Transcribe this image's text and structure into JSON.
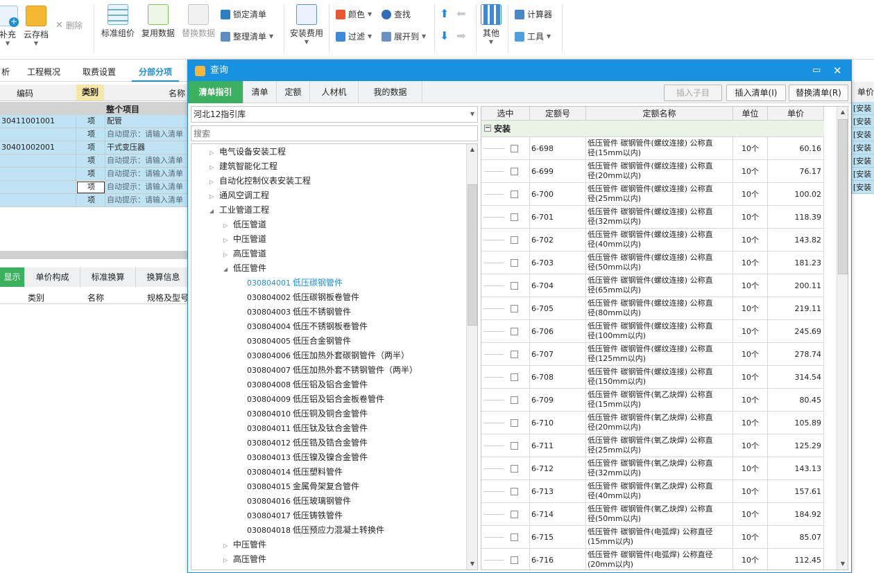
{
  "ribbon": {
    "supplement": "补充",
    "cloud_save": "云存档",
    "delete": "删除",
    "std_price": "标准组价",
    "reuse": "复用数据",
    "replace": "替换数据",
    "lock_list": "锁定清单",
    "arrange_list": "整理清单",
    "install_fee": "安装费用",
    "color": "颜色",
    "find": "查找",
    "filter": "过滤",
    "expand_to": "展开到",
    "other": "其他",
    "calculator": "计算器",
    "tools": "工具"
  },
  "main_tabs": [
    "析",
    "工程概况",
    "取费设置",
    "分部分项"
  ],
  "left_grid": {
    "headers": {
      "code": "编码",
      "type": "类别",
      "name": "名称"
    },
    "whole": "整个项目",
    "rows": [
      {
        "code": "30411001001",
        "type": "项",
        "name": "配管"
      },
      {
        "code": "",
        "type": "项",
        "name": "自动提示：请输入清单"
      },
      {
        "code": "30401002001",
        "type": "项",
        "name": "干式变压器"
      },
      {
        "code": "",
        "type": "项",
        "name": "自动提示：请输入清单"
      },
      {
        "code": "",
        "type": "项",
        "name": "自动提示：请输入清单"
      },
      {
        "code": "",
        "type": "项",
        "name": "自动提示：请输入清单"
      },
      {
        "code": "",
        "type": "项",
        "name": "自动提示：请输入清单"
      }
    ]
  },
  "right_strip": [
    "单价",
    "[安装",
    "[安装",
    "[安装",
    "[安装",
    "[安装",
    "[安装",
    "[安装"
  ],
  "lower_tabs": [
    "显示",
    "单价构成",
    "标准换算",
    "换算信息"
  ],
  "lower_headers": [
    "类别",
    "名称",
    "规格及型号"
  ],
  "dialog": {
    "title": "查询",
    "tabs": [
      "清单指引",
      "清单",
      "定额",
      "人材机",
      "我的数据"
    ],
    "btn_insert_child": "插入子目",
    "btn_insert_list": "插入清单(I)",
    "btn_replace_list": "替换清单(R)",
    "library": "河北12指引库",
    "search_placeholder": "搜索",
    "tree": [
      {
        "level": 1,
        "state": "closed",
        "code": "",
        "label": "电气设备安装工程"
      },
      {
        "level": 1,
        "state": "closed",
        "code": "",
        "label": "建筑智能化工程"
      },
      {
        "level": 1,
        "state": "closed",
        "code": "",
        "label": "自动化控制仪表安装工程"
      },
      {
        "level": 1,
        "state": "closed",
        "code": "",
        "label": "通风空调工程"
      },
      {
        "level": 1,
        "state": "open",
        "code": "",
        "label": "工业管道工程"
      },
      {
        "level": 2,
        "state": "closed",
        "code": "",
        "label": "低压管道"
      },
      {
        "level": 2,
        "state": "closed",
        "code": "",
        "label": "中压管道"
      },
      {
        "level": 2,
        "state": "closed",
        "code": "",
        "label": "高压管道"
      },
      {
        "level": 2,
        "state": "open",
        "code": "",
        "label": "低压管件"
      },
      {
        "level": 3,
        "state": "leaf",
        "code": "030804001",
        "label": "低压碳钢管件",
        "selected": true
      },
      {
        "level": 3,
        "state": "leaf",
        "code": "030804002",
        "label": "低压碳钢板卷管件"
      },
      {
        "level": 3,
        "state": "leaf",
        "code": "030804003",
        "label": "低压不锈钢管件"
      },
      {
        "level": 3,
        "state": "leaf",
        "code": "030804004",
        "label": "低压不锈钢板卷管件"
      },
      {
        "level": 3,
        "state": "leaf",
        "code": "030804005",
        "label": "低压合金钢管件"
      },
      {
        "level": 3,
        "state": "leaf",
        "code": "030804006",
        "label": "低压加热外套碳钢管件（两半）"
      },
      {
        "level": 3,
        "state": "leaf",
        "code": "030804007",
        "label": "低压加热外套不锈钢管件（两半）"
      },
      {
        "level": 3,
        "state": "leaf",
        "code": "030804008",
        "label": "低压铝及铝合金管件"
      },
      {
        "level": 3,
        "state": "leaf",
        "code": "030804009",
        "label": "低压铝及铝合金板卷管件"
      },
      {
        "level": 3,
        "state": "leaf",
        "code": "030804010",
        "label": "低压铜及铜合金管件"
      },
      {
        "level": 3,
        "state": "leaf",
        "code": "030804011",
        "label": "低压钛及钛合金管件"
      },
      {
        "level": 3,
        "state": "leaf",
        "code": "030804012",
        "label": "低压锆及锆合金管件"
      },
      {
        "level": 3,
        "state": "leaf",
        "code": "030804013",
        "label": "低压镍及镍合金管件"
      },
      {
        "level": 3,
        "state": "leaf",
        "code": "030804014",
        "label": "低压塑料管件"
      },
      {
        "level": 3,
        "state": "leaf",
        "code": "030804015",
        "label": "金属骨架复合管件"
      },
      {
        "level": 3,
        "state": "leaf",
        "code": "030804016",
        "label": "低压玻璃钢管件"
      },
      {
        "level": 3,
        "state": "leaf",
        "code": "030804017",
        "label": "低压铸铁管件"
      },
      {
        "level": 3,
        "state": "leaf",
        "code": "030804018",
        "label": "低压预应力混凝土转换件"
      },
      {
        "level": 2,
        "state": "closed",
        "code": "",
        "label": "中压管件"
      },
      {
        "level": 2,
        "state": "closed",
        "code": "",
        "label": "高压管件"
      }
    ],
    "table": {
      "headers": {
        "sel": "选中",
        "code": "定额号",
        "name": "定额名称",
        "unit": "单位",
        "price": "单价"
      },
      "group": "安装",
      "rows": [
        {
          "code": "6-698",
          "name1": "低压管件 碳钢管件(螺纹连接) 公称直",
          "name2": "径(15mm以内)",
          "unit": "10个",
          "price": "60.16"
        },
        {
          "code": "6-699",
          "name1": "低压管件 碳钢管件(螺纹连接) 公称直",
          "name2": "径(20mm以内)",
          "unit": "10个",
          "price": "76.17"
        },
        {
          "code": "6-700",
          "name1": "低压管件 碳钢管件(螺纹连接) 公称直",
          "name2": "径(25mm以内)",
          "unit": "10个",
          "price": "100.02"
        },
        {
          "code": "6-701",
          "name1": "低压管件 碳钢管件(螺纹连接) 公称直",
          "name2": "径(32mm以内)",
          "unit": "10个",
          "price": "118.39"
        },
        {
          "code": "6-702",
          "name1": "低压管件 碳钢管件(螺纹连接) 公称直",
          "name2": "径(40mm以内)",
          "unit": "10个",
          "price": "143.82"
        },
        {
          "code": "6-703",
          "name1": "低压管件 碳钢管件(螺纹连接) 公称直",
          "name2": "径(50mm以内)",
          "unit": "10个",
          "price": "181.23"
        },
        {
          "code": "6-704",
          "name1": "低压管件 碳钢管件(螺纹连接) 公称直",
          "name2": "径(65mm以内)",
          "unit": "10个",
          "price": "200.11"
        },
        {
          "code": "6-705",
          "name1": "低压管件 碳钢管件(螺纹连接) 公称直",
          "name2": "径(80mm以内)",
          "unit": "10个",
          "price": "219.11"
        },
        {
          "code": "6-706",
          "name1": "低压管件 碳钢管件(螺纹连接) 公称直",
          "name2": "径(100mm以内)",
          "unit": "10个",
          "price": "245.69"
        },
        {
          "code": "6-707",
          "name1": "低压管件 碳钢管件(螺纹连接) 公称直",
          "name2": "径(125mm以内)",
          "unit": "10个",
          "price": "278.74"
        },
        {
          "code": "6-708",
          "name1": "低压管件 碳钢管件(螺纹连接) 公称直",
          "name2": "径(150mm以内)",
          "unit": "10个",
          "price": "314.54"
        },
        {
          "code": "6-709",
          "name1": "低压管件 碳钢管件(氧乙炔焊) 公称直",
          "name2": "径(15mm以内)",
          "unit": "10个",
          "price": "80.45"
        },
        {
          "code": "6-710",
          "name1": "低压管件 碳钢管件(氧乙炔焊) 公称直",
          "name2": "径(20mm以内)",
          "unit": "10个",
          "price": "105.89"
        },
        {
          "code": "6-711",
          "name1": "低压管件 碳钢管件(氧乙炔焊) 公称直",
          "name2": "径(25mm以内)",
          "unit": "10个",
          "price": "125.29"
        },
        {
          "code": "6-712",
          "name1": "低压管件 碳钢管件(氧乙炔焊) 公称直",
          "name2": "径(32mm以内)",
          "unit": "10个",
          "price": "143.13"
        },
        {
          "code": "6-713",
          "name1": "低压管件 碳钢管件(氧乙炔焊) 公称直",
          "name2": "径(40mm以内)",
          "unit": "10个",
          "price": "157.61"
        },
        {
          "code": "6-714",
          "name1": "低压管件 碳钢管件(氧乙炔焊) 公称直",
          "name2": "径(50mm以内)",
          "unit": "10个",
          "price": "184.92"
        },
        {
          "code": "6-715",
          "name1": "低压管件 碳钢管件(电弧焊) 公称直径",
          "name2": "(15mm以内)",
          "unit": "10个",
          "price": "85.07"
        },
        {
          "code": "6-716",
          "name1": "低压管件 碳钢管件(电弧焊) 公称直径",
          "name2": "(20mm以内)",
          "unit": "10个",
          "price": "112.45"
        }
      ]
    }
  },
  "colors": {
    "accent": "#1a8fd6",
    "title_bar": "#1791e0",
    "active_tab": "#3bb05e",
    "row_blue": "#bfe3f3"
  }
}
